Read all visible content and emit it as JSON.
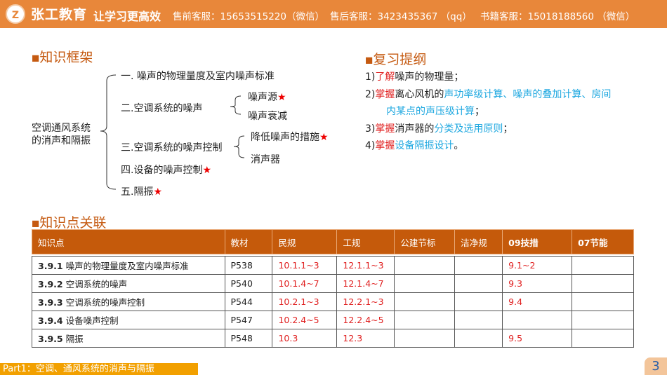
{
  "header": {
    "logo_mark": "Z",
    "brand": "张工教育",
    "slogan": "让学习更高效",
    "presale": "售前客服：15653515220（微信）",
    "aftersale": "售后客服：3423435367 （qq）",
    "books": "书籍客服：15018188560 （微信）"
  },
  "framework": {
    "title": "知识框架",
    "root": "空调通风系统的消声和隔振",
    "root_l1": "空调通风系统",
    "root_l2": "的消声和隔振",
    "items": [
      {
        "label": "一. 噪声的物理量度及室内噪声标准"
      },
      {
        "label": "二.空调系统的噪声",
        "subs": [
          "噪声源",
          "噪声衰减"
        ]
      },
      {
        "label": "三.空调系统的噪声控制",
        "subs": [
          "降低噪声的措施",
          "消声器"
        ]
      },
      {
        "label": "四.设备的噪声控制"
      },
      {
        "label": "五.隔振"
      }
    ],
    "star": "★"
  },
  "outline": {
    "title": "复习提纲",
    "items": [
      {
        "n": "1)",
        "v": "了解",
        "a": "噪声的物理量；"
      },
      {
        "n": "2)",
        "v": "掌握",
        "a": "离心风机的",
        "b": "声功率级计算、噪声的叠加计算、房间",
        "c": "内某点的声压级计算",
        "d": "；"
      },
      {
        "n": "3)",
        "v": "掌握",
        "a": "消声器的",
        "b": "分类及选用原则",
        "d": "；"
      },
      {
        "n": "4)",
        "v": "掌握",
        "b": "设备隔振设计",
        "d": "。"
      }
    ]
  },
  "relation": {
    "title": "知识点关联",
    "headers": [
      "知识点",
      "教材",
      "民规",
      "工规",
      "公建节标",
      "洁净规",
      "09技措",
      "07节能"
    ],
    "rows": [
      [
        "3.9.1",
        "噪声的物理量度及室内噪声标准",
        "P538",
        "10.1.1~3",
        "12.1.1~3",
        "",
        "",
        "9.1~2",
        ""
      ],
      [
        "3.9.2",
        "空调系统的噪声",
        "P540",
        "10.1.4~7",
        "12.1.4~7",
        "",
        "",
        "9.3",
        ""
      ],
      [
        "3.9.3",
        "空调系统的噪声控制",
        "P544",
        "10.2.1~3",
        "12.2.1~3",
        "",
        "",
        "9.4",
        ""
      ],
      [
        "3.9.4",
        "设备噪声控制",
        "P547",
        "10.2.4~5",
        "12.2.4~5",
        "",
        "",
        "",
        ""
      ],
      [
        "3.9.5",
        "隔振",
        "P548",
        "10.3",
        "12.3",
        "",
        "",
        "9.5",
        ""
      ]
    ]
  },
  "footer": {
    "part": "Part1：空调、通风系统的消声与隔振",
    "page": "3"
  },
  "colors": {
    "header": "#e8873a",
    "table_header": "#c55a0b",
    "accent_red": "#e02020",
    "accent_blue": "#1fa8e0"
  }
}
